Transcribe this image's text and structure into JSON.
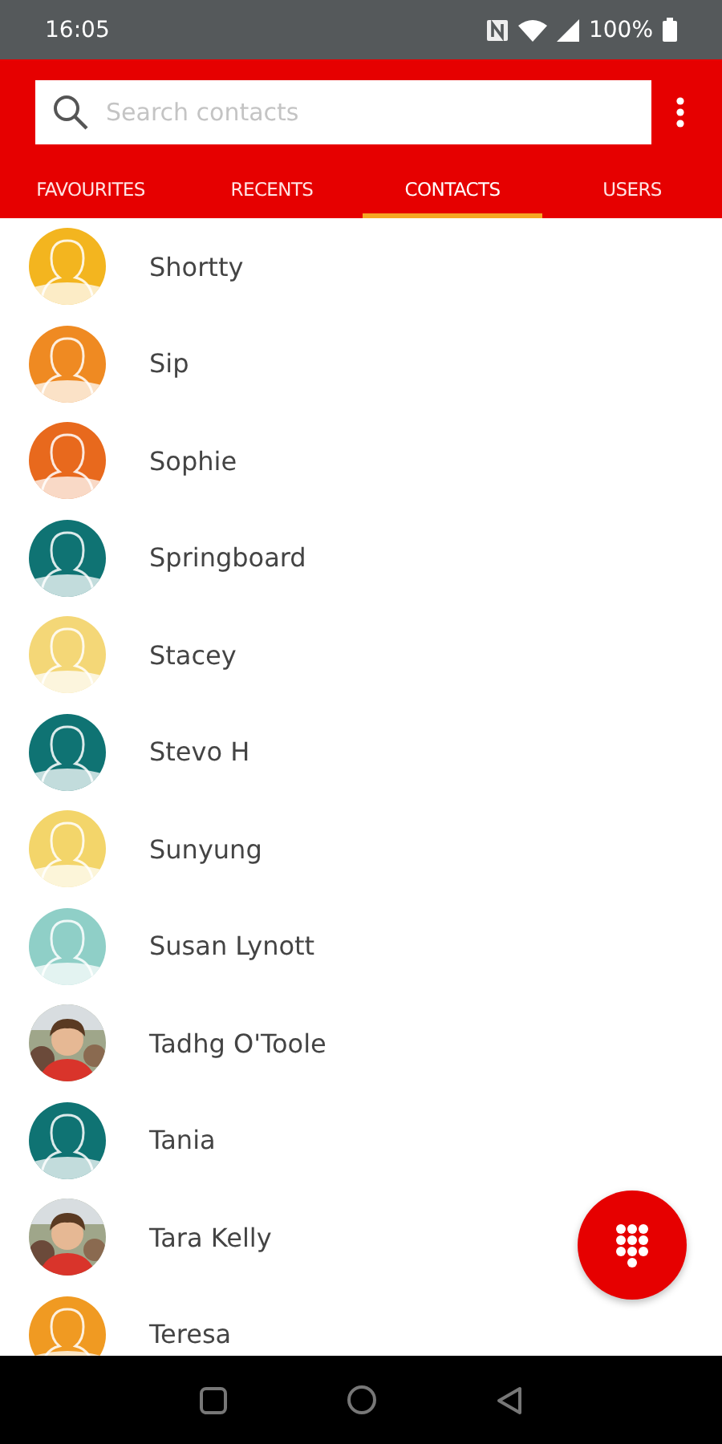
{
  "status_bar": {
    "time": "16:05",
    "battery": "100%"
  },
  "search": {
    "placeholder": "Search contacts"
  },
  "tabs": [
    {
      "label": "FAVOURITES",
      "selected": false
    },
    {
      "label": "RECENTS",
      "selected": false
    },
    {
      "label": "CONTACTS",
      "selected": true
    },
    {
      "label": "USERS",
      "selected": false
    }
  ],
  "contacts": [
    {
      "name": "Shortty",
      "kind": "placeholder",
      "color": "#f3b51f"
    },
    {
      "name": "Sip",
      "kind": "placeholder",
      "color": "#ef8a22"
    },
    {
      "name": "Sophie",
      "kind": "placeholder",
      "color": "#e8691d"
    },
    {
      "name": "Springboard",
      "kind": "placeholder",
      "color": "#0f7373"
    },
    {
      "name": "Stacey",
      "kind": "placeholder",
      "color": "#f4d777"
    },
    {
      "name": "Stevo H",
      "kind": "placeholder",
      "color": "#0f7373"
    },
    {
      "name": "Sunyung",
      "kind": "placeholder",
      "color": "#f3d56a"
    },
    {
      "name": "Susan Lynott",
      "kind": "placeholder",
      "color": "#8fcfc7"
    },
    {
      "name": "Tadhg O'Toole",
      "kind": "picture"
    },
    {
      "name": "Tania",
      "kind": "placeholder",
      "color": "#0f7373"
    },
    {
      "name": "Tara Kelly",
      "kind": "picture"
    },
    {
      "name": "Teresa",
      "kind": "placeholder",
      "color": "#f09a22"
    }
  ]
}
